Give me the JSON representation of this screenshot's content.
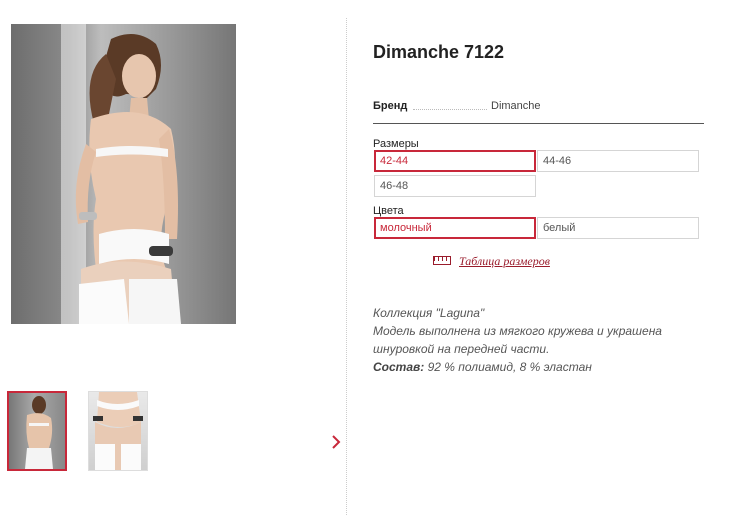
{
  "product": {
    "title": "Dimanche 7122",
    "brand_label": "Бренд",
    "brand_value": "Dimanche"
  },
  "sizes": {
    "label": "Размеры",
    "options": [
      "42-44",
      "44-46",
      "46-48"
    ],
    "selected": "42-44"
  },
  "colors": {
    "label": "Цвета",
    "options": [
      "молочный",
      "белый"
    ],
    "selected": "молочный"
  },
  "size_table_link": "Таблица размеров",
  "description": {
    "line1": "Коллекция \"Laguna\"",
    "line2": "Модель выполнена из мягкого кружева и украшена шнуровкой на передней части.",
    "composition_label": "Состав:",
    "composition_value": "92 % полиамид, 8 % эластан"
  },
  "gallery": {
    "next_icon": "chevron-right-icon",
    "accent_color": "#c8283a"
  }
}
